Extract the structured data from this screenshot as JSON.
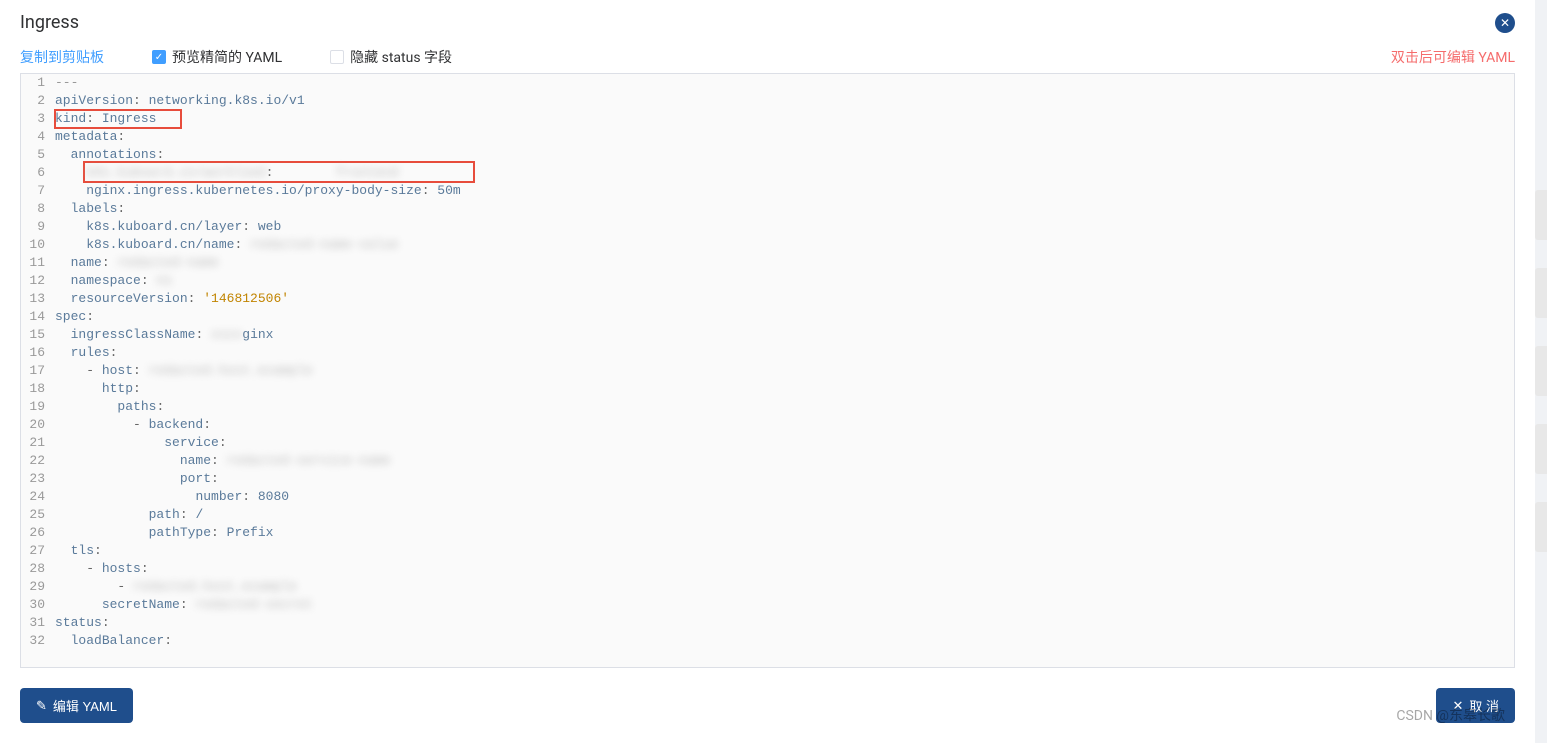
{
  "dialog": {
    "title": "Ingress",
    "close_label": "✕"
  },
  "toolbar": {
    "copy_label": "复制到剪贴板",
    "preview_label": "预览精简的 YAML",
    "preview_checked": true,
    "hide_status_label": "隐藏 status 字段",
    "hide_status_checked": false,
    "edit_hint": "双击后可编辑 YAML"
  },
  "yaml": {
    "lines": [
      {
        "n": 1,
        "tokens": [
          [
            "tok-comment",
            "---"
          ]
        ]
      },
      {
        "n": 2,
        "tokens": [
          [
            "tok-key",
            "apiVersion"
          ],
          [
            "tok-punc",
            ": "
          ],
          [
            "tok-val",
            "networking.k8s.io/v1"
          ]
        ]
      },
      {
        "n": 3,
        "tokens": [
          [
            "tok-key",
            "kind"
          ],
          [
            "tok-punc",
            ": "
          ],
          [
            "tok-val",
            "Ingress"
          ]
        ]
      },
      {
        "n": 4,
        "tokens": [
          [
            "tok-key",
            "metadata"
          ],
          [
            "tok-punc",
            ":"
          ]
        ]
      },
      {
        "n": 5,
        "tokens": [
          [
            "",
            "  "
          ],
          [
            "tok-key",
            "annotations"
          ],
          [
            "tok-punc",
            ":"
          ]
        ]
      },
      {
        "n": 6,
        "tokens": [
          [
            "",
            "    "
          ],
          [
            "tok-key blur",
            "k8s.kuboard.cn/workload"
          ],
          [
            "tok-punc",
            ": "
          ],
          [
            "",
            "       "
          ],
          [
            "tok-val blur",
            "frontend"
          ]
        ]
      },
      {
        "n": 7,
        "tokens": [
          [
            "",
            "    "
          ],
          [
            "tok-key",
            "nginx.ingress.kubernetes.io/proxy-body-size"
          ],
          [
            "tok-punc",
            ": "
          ],
          [
            "tok-val",
            "50m"
          ]
        ]
      },
      {
        "n": 8,
        "tokens": [
          [
            "",
            "  "
          ],
          [
            "tok-key",
            "labels"
          ],
          [
            "tok-punc",
            ":"
          ]
        ]
      },
      {
        "n": 9,
        "tokens": [
          [
            "",
            "    "
          ],
          [
            "tok-key",
            "k8s.kuboard.cn/layer"
          ],
          [
            "tok-punc",
            ": "
          ],
          [
            "tok-val",
            "web"
          ]
        ]
      },
      {
        "n": 10,
        "tokens": [
          [
            "",
            "    "
          ],
          [
            "tok-key",
            "k8s.kuboard.cn/name"
          ],
          [
            "tok-punc",
            ": "
          ],
          [
            "tok-val blur",
            "redacted-name-value"
          ]
        ]
      },
      {
        "n": 11,
        "tokens": [
          [
            "",
            "  "
          ],
          [
            "tok-key",
            "name"
          ],
          [
            "tok-punc",
            ": "
          ],
          [
            "tok-val blur",
            "redacted-name"
          ]
        ]
      },
      {
        "n": 12,
        "tokens": [
          [
            "",
            "  "
          ],
          [
            "tok-key",
            "namespace"
          ],
          [
            "tok-punc",
            ": "
          ],
          [
            "tok-val blur",
            "ns"
          ]
        ]
      },
      {
        "n": 13,
        "tokens": [
          [
            "",
            "  "
          ],
          [
            "tok-key",
            "resourceVersion"
          ],
          [
            "tok-punc",
            ": "
          ],
          [
            "tok-str",
            "'146812506'"
          ]
        ]
      },
      {
        "n": 14,
        "tokens": [
          [
            "tok-key",
            "spec"
          ],
          [
            "tok-punc",
            ":"
          ]
        ]
      },
      {
        "n": 15,
        "tokens": [
          [
            "",
            "  "
          ],
          [
            "tok-key",
            "ingressClassName"
          ],
          [
            "tok-punc",
            ": "
          ],
          [
            "tok-val blur",
            "xxxx"
          ],
          [
            "tok-val",
            "ginx"
          ]
        ]
      },
      {
        "n": 16,
        "tokens": [
          [
            "",
            "  "
          ],
          [
            "tok-key",
            "rules"
          ],
          [
            "tok-punc",
            ":"
          ]
        ]
      },
      {
        "n": 17,
        "tokens": [
          [
            "",
            "    "
          ],
          [
            "tok-dash",
            "- "
          ],
          [
            "tok-key",
            "host"
          ],
          [
            "tok-punc",
            ": "
          ],
          [
            "tok-val blur",
            "redacted.host.example"
          ]
        ]
      },
      {
        "n": 18,
        "tokens": [
          [
            "",
            "      "
          ],
          [
            "tok-key",
            "http"
          ],
          [
            "tok-punc",
            ":"
          ]
        ]
      },
      {
        "n": 19,
        "tokens": [
          [
            "",
            "        "
          ],
          [
            "tok-key",
            "paths"
          ],
          [
            "tok-punc",
            ":"
          ]
        ]
      },
      {
        "n": 20,
        "tokens": [
          [
            "",
            "          "
          ],
          [
            "tok-dash",
            "- "
          ],
          [
            "tok-key",
            "backend"
          ],
          [
            "tok-punc",
            ":"
          ]
        ]
      },
      {
        "n": 21,
        "tokens": [
          [
            "",
            "              "
          ],
          [
            "tok-key",
            "service"
          ],
          [
            "tok-punc",
            ":"
          ]
        ]
      },
      {
        "n": 22,
        "tokens": [
          [
            "",
            "                "
          ],
          [
            "tok-key",
            "name"
          ],
          [
            "tok-punc",
            ": "
          ],
          [
            "tok-val blur",
            "redacted-service-name"
          ]
        ]
      },
      {
        "n": 23,
        "tokens": [
          [
            "",
            "                "
          ],
          [
            "tok-key",
            "port"
          ],
          [
            "tok-punc",
            ":"
          ]
        ]
      },
      {
        "n": 24,
        "tokens": [
          [
            "",
            "                  "
          ],
          [
            "tok-key",
            "number"
          ],
          [
            "tok-punc",
            ": "
          ],
          [
            "tok-val",
            "8080"
          ]
        ]
      },
      {
        "n": 25,
        "tokens": [
          [
            "",
            "            "
          ],
          [
            "tok-key",
            "path"
          ],
          [
            "tok-punc",
            ": "
          ],
          [
            "tok-val",
            "/"
          ]
        ]
      },
      {
        "n": 26,
        "tokens": [
          [
            "",
            "            "
          ],
          [
            "tok-key",
            "pathType"
          ],
          [
            "tok-punc",
            ": "
          ],
          [
            "tok-val",
            "Prefix"
          ]
        ]
      },
      {
        "n": 27,
        "tokens": [
          [
            "",
            "  "
          ],
          [
            "tok-key",
            "tls"
          ],
          [
            "tok-punc",
            ":"
          ]
        ]
      },
      {
        "n": 28,
        "tokens": [
          [
            "",
            "    "
          ],
          [
            "tok-dash",
            "- "
          ],
          [
            "tok-key",
            "hosts"
          ],
          [
            "tok-punc",
            ":"
          ]
        ]
      },
      {
        "n": 29,
        "tokens": [
          [
            "",
            "        "
          ],
          [
            "tok-dash",
            "- "
          ],
          [
            "tok-val blur",
            "redacted.host.example"
          ]
        ]
      },
      {
        "n": 30,
        "tokens": [
          [
            "",
            "      "
          ],
          [
            "tok-key",
            "secretName"
          ],
          [
            "tok-punc",
            ": "
          ],
          [
            "tok-val blur",
            "redacted-secret"
          ]
        ]
      },
      {
        "n": 31,
        "tokens": [
          [
            "tok-key",
            "status"
          ],
          [
            "tok-punc",
            ":"
          ]
        ]
      },
      {
        "n": 32,
        "tokens": [
          [
            "",
            "  "
          ],
          [
            "tok-key",
            "loadBalancer"
          ],
          [
            "tok-punc",
            ":"
          ]
        ]
      }
    ]
  },
  "footer": {
    "edit_label": "编辑 YAML",
    "cancel_label": "取 消"
  },
  "watermark": "CSDN @东皋长歌"
}
